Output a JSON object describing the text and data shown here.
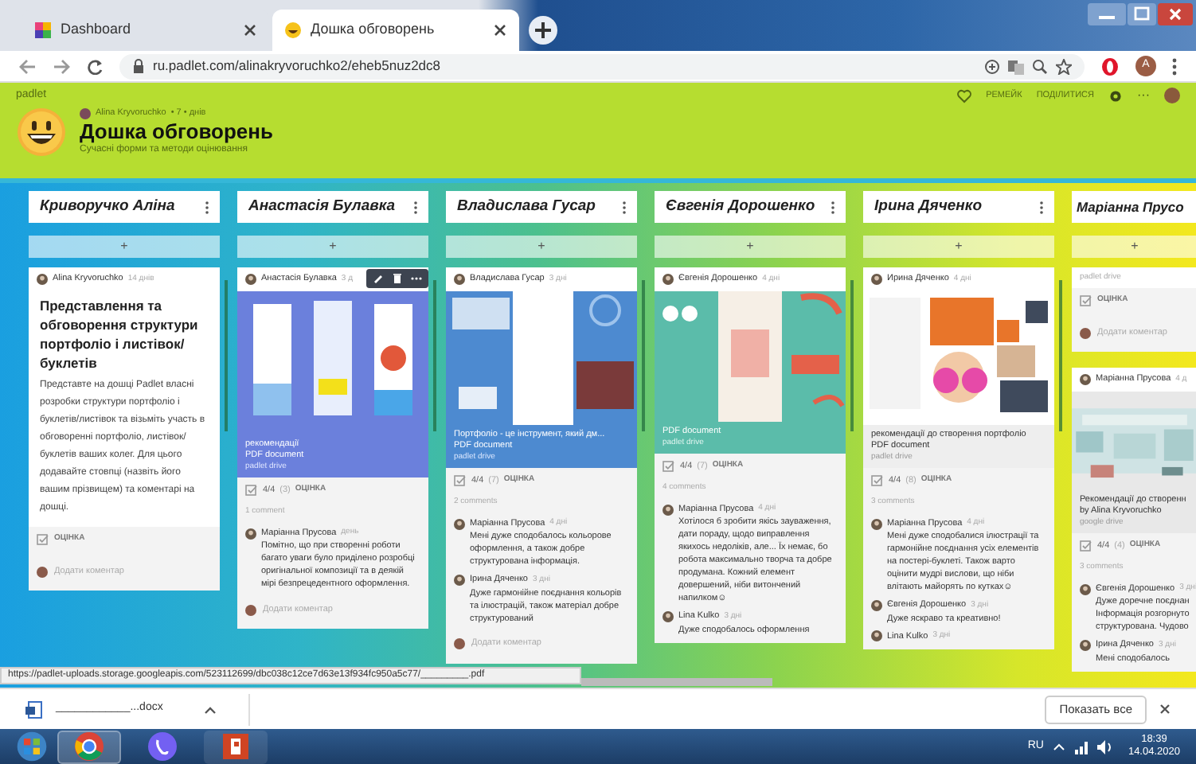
{
  "browser": {
    "tabs": [
      {
        "label": "Dashboard",
        "selected": false
      },
      {
        "label": "Дошка обговорень",
        "selected": true
      }
    ],
    "url": "ru.padlet.com/alinakryvoruchko2/eheb5nuz2dc8",
    "profile": "A"
  },
  "padlet": {
    "logo": "padlet",
    "actions": [
      "РЕМЕЙК",
      "ПОДІЛИТИСЯ"
    ],
    "more": "···",
    "owner": "Alina Kryvoruchko",
    "meta": "• 7 • днів",
    "title": "Дошка обговорень",
    "subtitle": "Сучасні форми та методи оцінювання"
  },
  "columns": [
    {
      "title": "Криворучко Аліна",
      "add": "+",
      "cards": [
        {
          "author": "Alina Kryvoruchko",
          "time": "14 днів",
          "title": "Представлення та обговорення структури портфоліо і листівок/буклетів",
          "body": "Представте на дошці Padlet власні розробки структури портфоліо і буклетів/листівок та візьміть участь в обговоренні портфоліо, листівок/буклетів ваших колег. Для цього додавайте стовпці (назвіть його вашим прізвищем) та коментарі на дошці.",
          "rating": {
            "label": "ОЦІНКА"
          },
          "add_comment": "Додати коментар"
        }
      ]
    },
    {
      "title": "Анастасія Булавка",
      "add": "+",
      "cards": [
        {
          "author": "Анастасія Булавка",
          "time": "3 д",
          "hover_toolbar": true,
          "attachment": {
            "title": "рекомендації",
            "type": "PDF document",
            "source": "padlet drive"
          },
          "rating": {
            "score": "4/4",
            "count": "(3)",
            "label": "ОЦІНКА"
          },
          "comments_label": "1 comment",
          "comments": [
            {
              "author": "Маріанна Прусова",
              "time": "день",
              "text": "Помітно, що при створенні роботи багато уваги було приділено розробці оригінальної композиції та в деякій мірі безпрецедентного оформлення."
            }
          ],
          "add_comment": "Додати коментар"
        }
      ]
    },
    {
      "title": "Владислава Гусар",
      "add": "+",
      "cards": [
        {
          "author": "Владислава Гусар",
          "time": "3 дні",
          "attachment": {
            "title": "Портфоліо - це інструмент, який дм...",
            "type": "PDF document",
            "source": "padlet drive"
          },
          "rating": {
            "score": "4/4",
            "count": "(7)",
            "label": "ОЦІНКА"
          },
          "comments_label": "2 comments",
          "comments": [
            {
              "author": "Маріанна Прусова",
              "time": "4 дні",
              "text": "Мені дуже сподобалось кольорове оформлення, а також добре структурована інформація."
            },
            {
              "author": "Ірина Дяченко",
              "time": "3 дні",
              "text": "Дуже гармонійне поєднання кольорів та ілюстрацій, також матеріал добре структурований"
            }
          ],
          "add_comment": "Додати коментар"
        }
      ]
    },
    {
      "title": "Євгенія Дорошенко",
      "add": "+",
      "cards": [
        {
          "author": "Євгенія Дорошенко",
          "time": "4 дні",
          "attachment": {
            "type": "PDF document",
            "source": "padlet drive"
          },
          "rating": {
            "score": "4/4",
            "count": "(7)",
            "label": "ОЦІНКА"
          },
          "comments_label": "4 comments",
          "comments": [
            {
              "author": "Маріанна Прусова",
              "time": "4 дні",
              "text": "Хотілося б зробити якісь зауваження, дати пораду, щодо виправлення якихось недоліків, але... Їх немає, бо робота максимально творча та добре продумана. Кожний елемент довершений, ніби витончений напилком☺"
            },
            {
              "author": "Lina Kulko",
              "time": "3 дні",
              "text": "Дуже сподобалось оформлення"
            }
          ]
        }
      ]
    },
    {
      "title": "Ірина Дяченко",
      "add": "+",
      "cards": [
        {
          "author": "Ирина Дяченко",
          "time": "4 дні",
          "attachment": {
            "title": "рекомендації до створення портфоліо",
            "type": "PDF document",
            "source": "padlet drive"
          },
          "rating": {
            "score": "4/4",
            "count": "(8)",
            "label": "ОЦІНКА"
          },
          "comments_label": "3 comments",
          "comments": [
            {
              "author": "Маріанна Прусова",
              "time": "4 дні",
              "text": "Мені дуже сподобалися ілюстрації та гармонійне поєднання усіх елементів на постері-буклеті. Також варто оцінити мудрі вислови, що ніби влітають майорять по кутках☺"
            },
            {
              "author": "Євгенія Дорошенко",
              "time": "3 дні",
              "text": "Дуже яскраво та креативно!"
            },
            {
              "author": "Lina Kulko",
              "time": "3 дні"
            }
          ]
        }
      ]
    },
    {
      "title": "Маріанна Прусо",
      "add": "+",
      "cards": [
        {
          "attachment": {
            "source": "padlet drive"
          },
          "rating": {
            "label": "ОЦІНКА"
          },
          "add_comment": "Додати коментар"
        },
        {
          "author": "Маріанна Прусова",
          "time": "4 д",
          "attachment": {
            "title": "Рекомендації до створенн",
            "type": "by Alina Kryvoruchko",
            "source": "google drive"
          },
          "rating": {
            "score": "4/4",
            "count": "(4)",
            "label": "ОЦІНКА"
          },
          "comments_label": "3 comments",
          "comments": [
            {
              "author": "Євгенія Дорошенко",
              "time": "3 дні",
              "text": "Дуже доречне поєднан Інформація розгорнуто структурована. Чудово"
            },
            {
              "author": "Ірина Дяченко",
              "time": "3 дні",
              "text": "Мені сподобалось"
            }
          ]
        }
      ]
    }
  ],
  "status_url": "https://padlet-uploads.storage.googleapis.com/523112699/dbc038c12ce7d63e13f934fc950a5c77/_________.pdf",
  "download": {
    "file": "____________...docx",
    "show_all": "Показать все"
  },
  "taskbar": {
    "language": "RU",
    "time": "18:39",
    "date": "14.04.2020"
  }
}
